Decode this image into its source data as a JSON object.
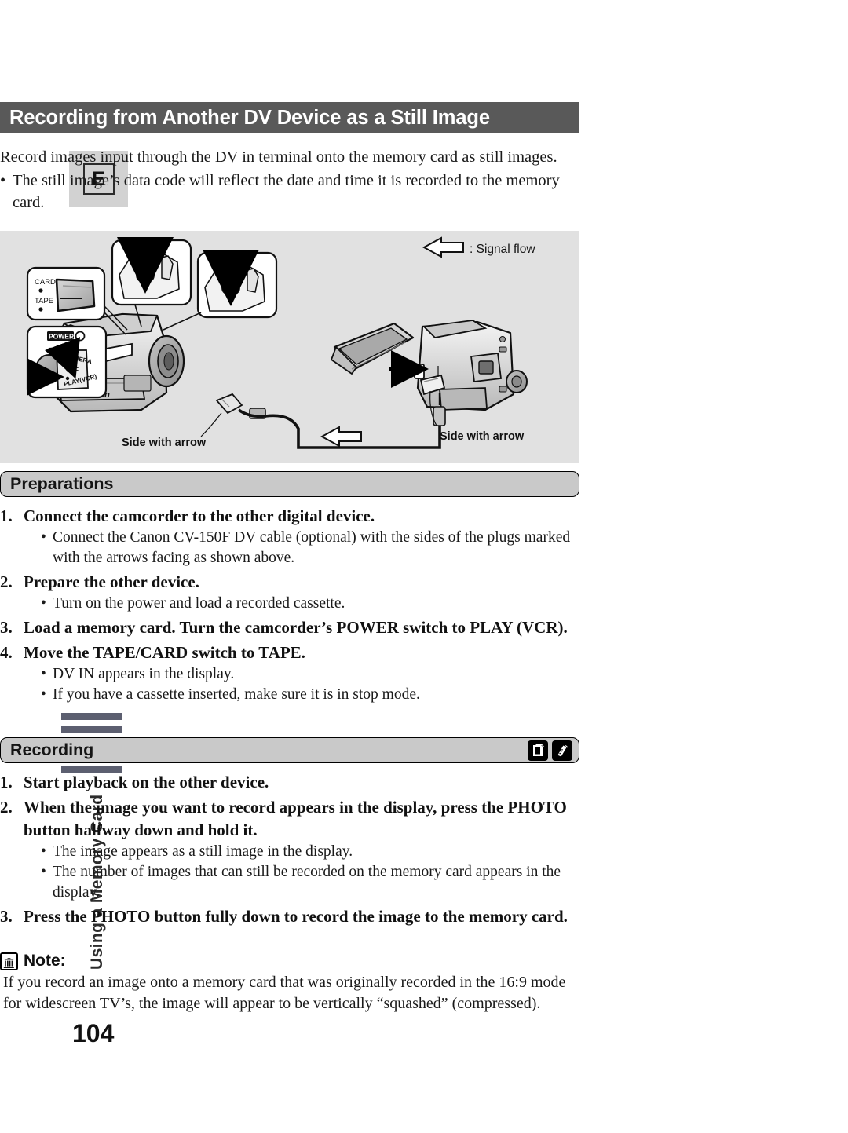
{
  "page": {
    "number": "104",
    "language_tab": "E",
    "side_tab_text": "Using a Memory Card",
    "side_bar_count": 5
  },
  "header": {
    "title": "Recording from Another DV Device as a Still Image"
  },
  "intro": {
    "paragraph": "Record images input through the DV in terminal onto the memory card as still images.",
    "bullet": "The still image’s data code will reflect the date and time it is recorded to the memory card.",
    "bullet_marker": "•"
  },
  "figure": {
    "legend_text": ": Signal flow",
    "legend_icon": "left-arrow-outline",
    "switch_inset": {
      "top_label": "CARD",
      "bottom_label": "TAPE"
    },
    "power_inset": {
      "badge": "POWER",
      "options": [
        "CAMERA",
        "OFF",
        "PLAY(VCR)"
      ]
    },
    "cable_label_left": "Side with arrow",
    "cable_label_right": "Side with arrow",
    "brand": "Canon"
  },
  "preparations": {
    "heading": "Preparations",
    "steps": [
      {
        "num": "1.",
        "head": "Connect the camcorder to the other digital device.",
        "subs": [
          "Connect the Canon CV-150F DV cable (optional) with the sides of the plugs marked with the arrows facing as shown above."
        ]
      },
      {
        "num": "2.",
        "head": "Prepare the other device.",
        "subs": [
          "Turn on the power and load a recorded cassette."
        ]
      },
      {
        "num": "3.",
        "head": "Load a memory card. Turn the camcorder’s POWER switch to PLAY (VCR).",
        "subs": []
      },
      {
        "num": "4.",
        "head": "Move the TAPE/CARD switch to TAPE.",
        "subs": [
          "DV IN appears in the display.",
          "If you have a cassette inserted, make sure it is in stop mode."
        ]
      }
    ]
  },
  "recording": {
    "heading": "Recording",
    "icons": [
      "memory-card-icon",
      "remote-control-icon"
    ],
    "steps": [
      {
        "num": "1.",
        "head": "Start playback on the other device.",
        "subs": []
      },
      {
        "num": "2.",
        "head": "When the image you want to record appears in the display, press the PHOTO button halfway down and hold it.",
        "subs": [
          "The image appears as a still image in the display.",
          "The number of images that can still be recorded on the memory card appears in the display."
        ]
      },
      {
        "num": "3.",
        "head": "Press the PHOTO button fully down to record the image to the memory card.",
        "subs": []
      }
    ]
  },
  "note": {
    "label": "Note:",
    "icon": "note-memo-icon",
    "bullet_marker": "•",
    "text": "If you record an image onto a memory card that was originally recorded in the 16:9 mode for widescreen TV’s, the image will appear to be vertically “squashed” (compressed)."
  },
  "colors": {
    "title_bar": "#595959",
    "pill_fill": "#c9c9c9",
    "figure_bg": "#e1e1e1",
    "side_bar": "#5c5f70",
    "lang_tab_bg": "#d2d2d2"
  }
}
